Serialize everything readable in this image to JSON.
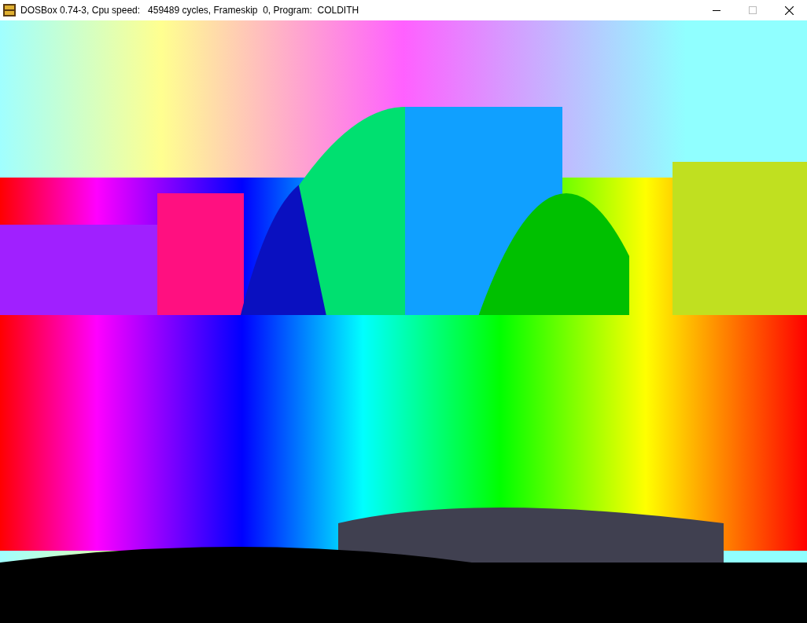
{
  "window": {
    "title": "DOSBox 0.74-3, Cpu speed:   459489 cycles, Frameskip  0, Program:  COLDITH"
  }
}
